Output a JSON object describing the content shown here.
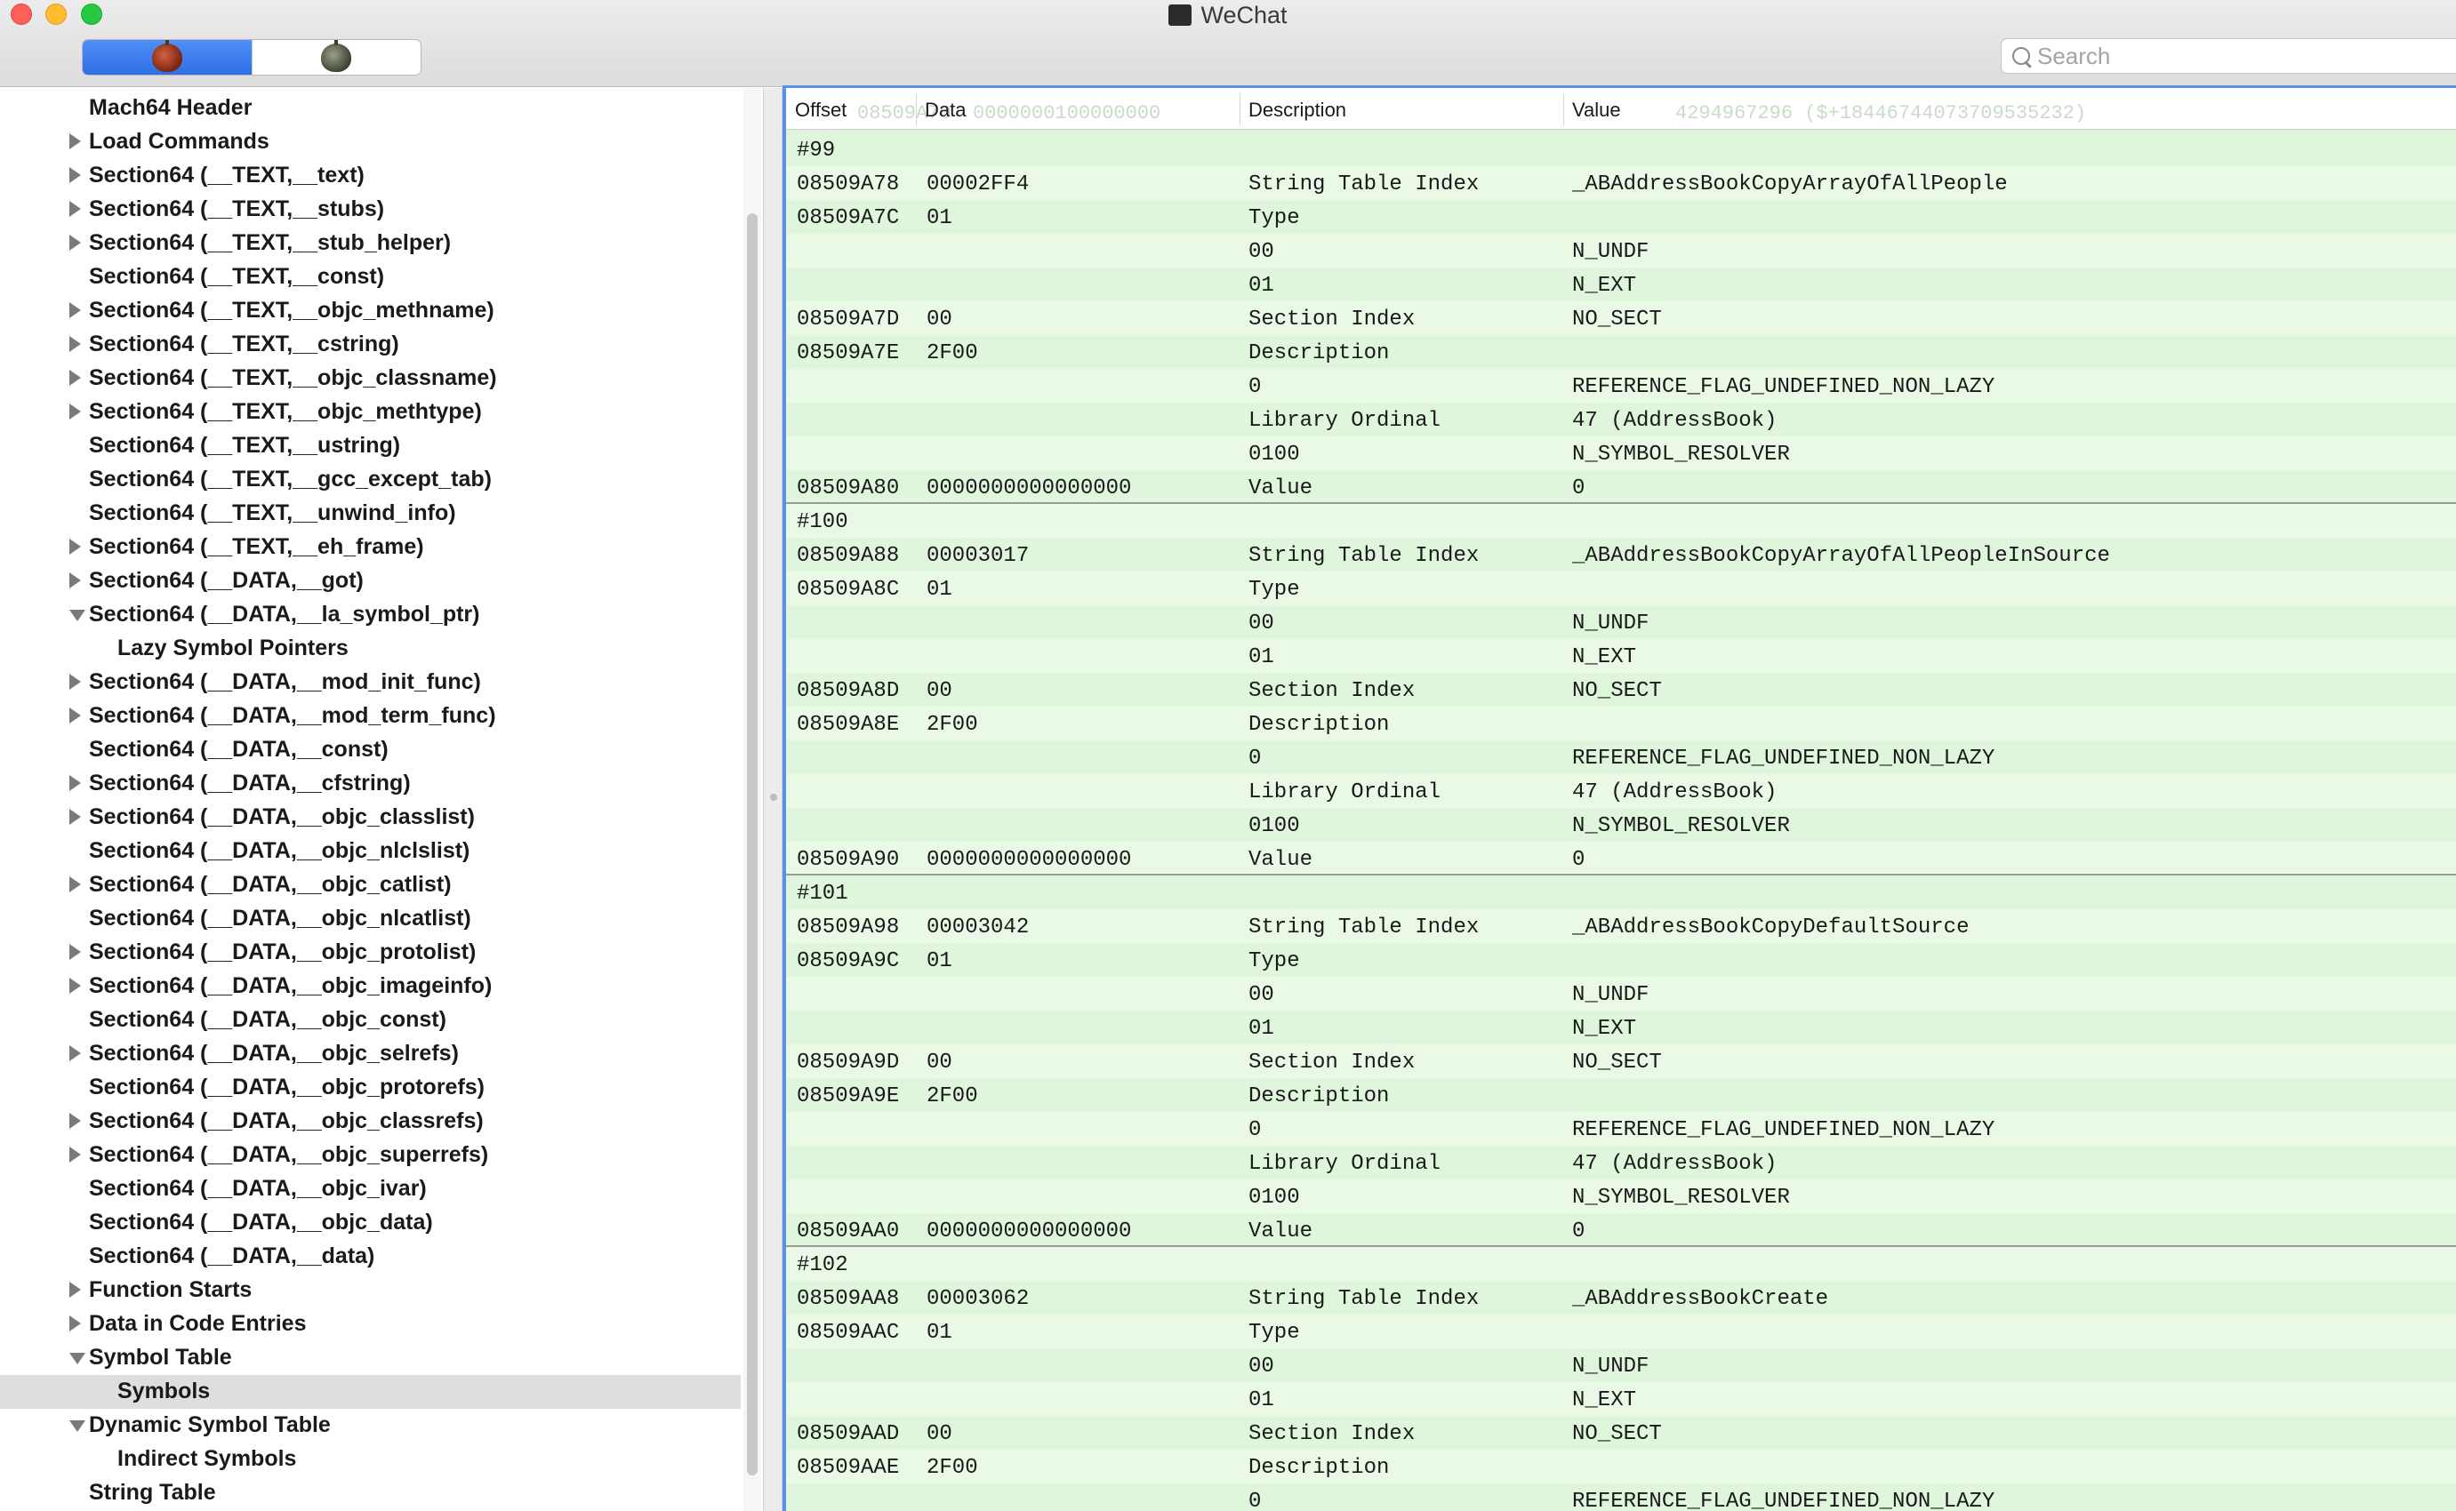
{
  "window": {
    "title": "WeChat",
    "search_placeholder": "Search"
  },
  "tree": [
    {
      "label": "Mach64 Header",
      "level": 0,
      "toggle": "none"
    },
    {
      "label": "Load Commands",
      "level": 0,
      "toggle": "right"
    },
    {
      "label": "Section64 (__TEXT,__text)",
      "level": 0,
      "toggle": "right"
    },
    {
      "label": "Section64 (__TEXT,__stubs)",
      "level": 0,
      "toggle": "right"
    },
    {
      "label": "Section64 (__TEXT,__stub_helper)",
      "level": 0,
      "toggle": "right"
    },
    {
      "label": "Section64 (__TEXT,__const)",
      "level": 0,
      "toggle": "none"
    },
    {
      "label": "Section64 (__TEXT,__objc_methname)",
      "level": 0,
      "toggle": "right"
    },
    {
      "label": "Section64 (__TEXT,__cstring)",
      "level": 0,
      "toggle": "right"
    },
    {
      "label": "Section64 (__TEXT,__objc_classname)",
      "level": 0,
      "toggle": "right"
    },
    {
      "label": "Section64 (__TEXT,__objc_methtype)",
      "level": 0,
      "toggle": "right"
    },
    {
      "label": "Section64 (__TEXT,__ustring)",
      "level": 0,
      "toggle": "none"
    },
    {
      "label": "Section64 (__TEXT,__gcc_except_tab)",
      "level": 0,
      "toggle": "none"
    },
    {
      "label": "Section64 (__TEXT,__unwind_info)",
      "level": 0,
      "toggle": "none"
    },
    {
      "label": "Section64 (__TEXT,__eh_frame)",
      "level": 0,
      "toggle": "right"
    },
    {
      "label": "Section64 (__DATA,__got)",
      "level": 0,
      "toggle": "right"
    },
    {
      "label": "Section64 (__DATA,__la_symbol_ptr)",
      "level": 0,
      "toggle": "down"
    },
    {
      "label": "Lazy Symbol Pointers",
      "level": 1,
      "toggle": "none"
    },
    {
      "label": "Section64 (__DATA,__mod_init_func)",
      "level": 0,
      "toggle": "right"
    },
    {
      "label": "Section64 (__DATA,__mod_term_func)",
      "level": 0,
      "toggle": "right"
    },
    {
      "label": "Section64 (__DATA,__const)",
      "level": 0,
      "toggle": "none"
    },
    {
      "label": "Section64 (__DATA,__cfstring)",
      "level": 0,
      "toggle": "right"
    },
    {
      "label": "Section64 (__DATA,__objc_classlist)",
      "level": 0,
      "toggle": "right"
    },
    {
      "label": "Section64 (__DATA,__objc_nlclslist)",
      "level": 0,
      "toggle": "none"
    },
    {
      "label": "Section64 (__DATA,__objc_catlist)",
      "level": 0,
      "toggle": "right"
    },
    {
      "label": "Section64 (__DATA,__objc_nlcatlist)",
      "level": 0,
      "toggle": "none"
    },
    {
      "label": "Section64 (__DATA,__objc_protolist)",
      "level": 0,
      "toggle": "right"
    },
    {
      "label": "Section64 (__DATA,__objc_imageinfo)",
      "level": 0,
      "toggle": "right"
    },
    {
      "label": "Section64 (__DATA,__objc_const)",
      "level": 0,
      "toggle": "none"
    },
    {
      "label": "Section64 (__DATA,__objc_selrefs)",
      "level": 0,
      "toggle": "right"
    },
    {
      "label": "Section64 (__DATA,__objc_protorefs)",
      "level": 0,
      "toggle": "none"
    },
    {
      "label": "Section64 (__DATA,__objc_classrefs)",
      "level": 0,
      "toggle": "right"
    },
    {
      "label": "Section64 (__DATA,__objc_superrefs)",
      "level": 0,
      "toggle": "right"
    },
    {
      "label": "Section64 (__DATA,__objc_ivar)",
      "level": 0,
      "toggle": "none"
    },
    {
      "label": "Section64 (__DATA,__objc_data)",
      "level": 0,
      "toggle": "none"
    },
    {
      "label": "Section64 (__DATA,__data)",
      "level": 0,
      "toggle": "none"
    },
    {
      "label": "Function Starts",
      "level": 0,
      "toggle": "right"
    },
    {
      "label": "Data in Code Entries",
      "level": 0,
      "toggle": "right"
    },
    {
      "label": "Symbol Table",
      "level": 0,
      "toggle": "down"
    },
    {
      "label": "Symbols",
      "level": 1,
      "toggle": "none",
      "selected": true
    },
    {
      "label": "Dynamic Symbol Table",
      "level": 0,
      "toggle": "down"
    },
    {
      "label": "Indirect Symbols",
      "level": 1,
      "toggle": "none"
    },
    {
      "label": "String Table",
      "level": 0,
      "toggle": "none"
    }
  ],
  "table": {
    "columns": [
      "Offset",
      "Data",
      "Description",
      "Value"
    ],
    "ghost_header": [
      "08509A70",
      "0000000100000000",
      "4294967296 ($+18446744073709535232)"
    ],
    "rows": [
      {
        "offset": "#99",
        "data": "",
        "desc": "",
        "value": ""
      },
      {
        "offset": "08509A78",
        "data": "00002FF4",
        "desc": "String Table Index",
        "value": "_ABAddressBookCopyArrayOfAllPeople"
      },
      {
        "offset": "08509A7C",
        "data": "01",
        "desc": "Type",
        "value": ""
      },
      {
        "offset": "",
        "data": "",
        "desc": "00",
        "value": "N_UNDF"
      },
      {
        "offset": "",
        "data": "",
        "desc": "01",
        "value": "N_EXT"
      },
      {
        "offset": "08509A7D",
        "data": "00",
        "desc": "Section Index",
        "value": "NO_SECT"
      },
      {
        "offset": "08509A7E",
        "data": "2F00",
        "desc": "Description",
        "value": ""
      },
      {
        "offset": "",
        "data": "",
        "desc": "0",
        "value": "REFERENCE_FLAG_UNDEFINED_NON_LAZY"
      },
      {
        "offset": "",
        "data": "",
        "desc": "Library Ordinal",
        "value": "47 (AddressBook)"
      },
      {
        "offset": "",
        "data": "",
        "desc": "0100",
        "value": "N_SYMBOL_RESOLVER"
      },
      {
        "offset": "08509A80",
        "data": "0000000000000000",
        "desc": "Value",
        "value": "0",
        "boundary": true
      },
      {
        "offset": "#100",
        "data": "",
        "desc": "",
        "value": ""
      },
      {
        "offset": "08509A88",
        "data": "00003017",
        "desc": "String Table Index",
        "value": "_ABAddressBookCopyArrayOfAllPeopleInSource"
      },
      {
        "offset": "08509A8C",
        "data": "01",
        "desc": "Type",
        "value": ""
      },
      {
        "offset": "",
        "data": "",
        "desc": "00",
        "value": "N_UNDF"
      },
      {
        "offset": "",
        "data": "",
        "desc": "01",
        "value": "N_EXT"
      },
      {
        "offset": "08509A8D",
        "data": "00",
        "desc": "Section Index",
        "value": "NO_SECT"
      },
      {
        "offset": "08509A8E",
        "data": "2F00",
        "desc": "Description",
        "value": ""
      },
      {
        "offset": "",
        "data": "",
        "desc": "0",
        "value": "REFERENCE_FLAG_UNDEFINED_NON_LAZY"
      },
      {
        "offset": "",
        "data": "",
        "desc": "Library Ordinal",
        "value": "47 (AddressBook)"
      },
      {
        "offset": "",
        "data": "",
        "desc": "0100",
        "value": "N_SYMBOL_RESOLVER"
      },
      {
        "offset": "08509A90",
        "data": "0000000000000000",
        "desc": "Value",
        "value": "0",
        "boundary": true
      },
      {
        "offset": "#101",
        "data": "",
        "desc": "",
        "value": ""
      },
      {
        "offset": "08509A98",
        "data": "00003042",
        "desc": "String Table Index",
        "value": "_ABAddressBookCopyDefaultSource"
      },
      {
        "offset": "08509A9C",
        "data": "01",
        "desc": "Type",
        "value": ""
      },
      {
        "offset": "",
        "data": "",
        "desc": "00",
        "value": "N_UNDF"
      },
      {
        "offset": "",
        "data": "",
        "desc": "01",
        "value": "N_EXT"
      },
      {
        "offset": "08509A9D",
        "data": "00",
        "desc": "Section Index",
        "value": "NO_SECT"
      },
      {
        "offset": "08509A9E",
        "data": "2F00",
        "desc": "Description",
        "value": ""
      },
      {
        "offset": "",
        "data": "",
        "desc": "0",
        "value": "REFERENCE_FLAG_UNDEFINED_NON_LAZY"
      },
      {
        "offset": "",
        "data": "",
        "desc": "Library Ordinal",
        "value": "47 (AddressBook)"
      },
      {
        "offset": "",
        "data": "",
        "desc": "0100",
        "value": "N_SYMBOL_RESOLVER"
      },
      {
        "offset": "08509AA0",
        "data": "0000000000000000",
        "desc": "Value",
        "value": "0",
        "boundary": true
      },
      {
        "offset": "#102",
        "data": "",
        "desc": "",
        "value": ""
      },
      {
        "offset": "08509AA8",
        "data": "00003062",
        "desc": "String Table Index",
        "value": "_ABAddressBookCreate"
      },
      {
        "offset": "08509AAC",
        "data": "01",
        "desc": "Type",
        "value": ""
      },
      {
        "offset": "",
        "data": "",
        "desc": "00",
        "value": "N_UNDF"
      },
      {
        "offset": "",
        "data": "",
        "desc": "01",
        "value": "N_EXT"
      },
      {
        "offset": "08509AAD",
        "data": "00",
        "desc": "Section Index",
        "value": "NO_SECT"
      },
      {
        "offset": "08509AAE",
        "data": "2F00",
        "desc": "Description",
        "value": ""
      },
      {
        "offset": "",
        "data": "",
        "desc": "0",
        "value": "REFERENCE_FLAG_UNDEFINED_NON_LAZY"
      }
    ]
  }
}
